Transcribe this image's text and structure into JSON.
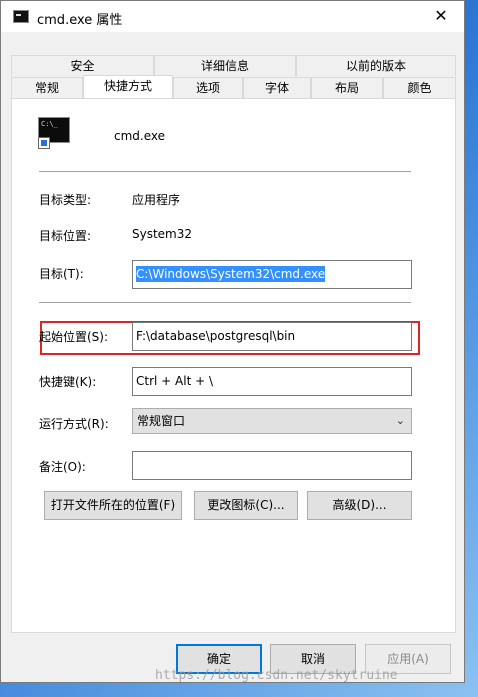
{
  "window": {
    "title": "cmd.exe 属性",
    "close_glyph": "✕"
  },
  "tabs_row1": [
    "安全",
    "详细信息",
    "以前的版本"
  ],
  "tabs_row2": [
    "常规",
    "快捷方式",
    "选项",
    "字体",
    "布局",
    "颜色"
  ],
  "active_tab": "快捷方式",
  "icon": {
    "cmd_glyph": "C:\\_",
    "semantic": "cmd-icon"
  },
  "file_name": "cmd.exe",
  "fields": {
    "target_type_label": "目标类型:",
    "target_type_value": "应用程序",
    "target_location_label": "目标位置:",
    "target_location_value": "System32",
    "target_label": "目标(T):",
    "target_value": "C:\\Windows\\System32\\cmd.exe",
    "start_in_label": "起始位置(S):",
    "start_in_value": "F:\\database\\postgresql\\bin",
    "shortcut_key_label": "快捷键(K):",
    "shortcut_key_value": "Ctrl + Alt + \\",
    "run_label": "运行方式(R):",
    "run_value": "常规窗口",
    "comment_label": "备注(O):",
    "comment_value": ""
  },
  "buttons": {
    "open_location": "打开文件所在的位置(F)",
    "change_icon": "更改图标(C)...",
    "advanced": "高级(D)..."
  },
  "footer": {
    "ok": "确定",
    "cancel": "取消",
    "apply": "应用(A)"
  },
  "watermark": "https://blog.csdn.net/skytruine",
  "colors": {
    "highlight_border": "#e02424",
    "selection": "#3390ff",
    "default_button": "#0078d7"
  }
}
